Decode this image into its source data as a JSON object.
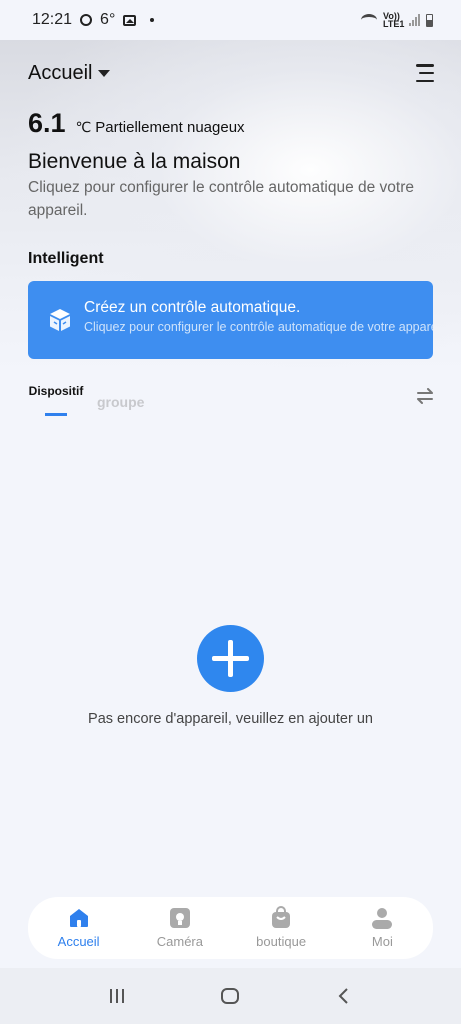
{
  "status_bar": {
    "time": "12:21",
    "temp": "6°",
    "network": "Vo)) LTE1"
  },
  "header": {
    "home_title": "Accueil"
  },
  "weather": {
    "temperature": "6.1",
    "unit": "℃",
    "condition": "Partiellement nuageux"
  },
  "welcome": {
    "title": "Bienvenue à la maison",
    "subtitle": "Cliquez pour configurer le contrôle automatique de votre appareil."
  },
  "smart": {
    "section_title": "Intelligent",
    "card_title": "Créez un contrôle automatique.",
    "card_subtitle": "Cliquez pour configurer le contrôle automatique de votre appareil."
  },
  "tabs": {
    "devices": "Dispositif",
    "group": "groupe"
  },
  "empty_state": {
    "message": "Pas encore d'appareil, veuillez en ajouter un"
  },
  "bottom_nav": {
    "items": [
      {
        "label": "Accueil",
        "icon": "home-icon",
        "active": true
      },
      {
        "label": "Caméra",
        "icon": "camera-icon",
        "active": false
      },
      {
        "label": "boutique",
        "icon": "shop-bag-icon",
        "active": false
      },
      {
        "label": "Moi",
        "icon": "person-icon",
        "active": false
      }
    ]
  },
  "colors": {
    "accent": "#2f80ed",
    "card": "#3e8ef0",
    "background": "#f3f5fb"
  }
}
